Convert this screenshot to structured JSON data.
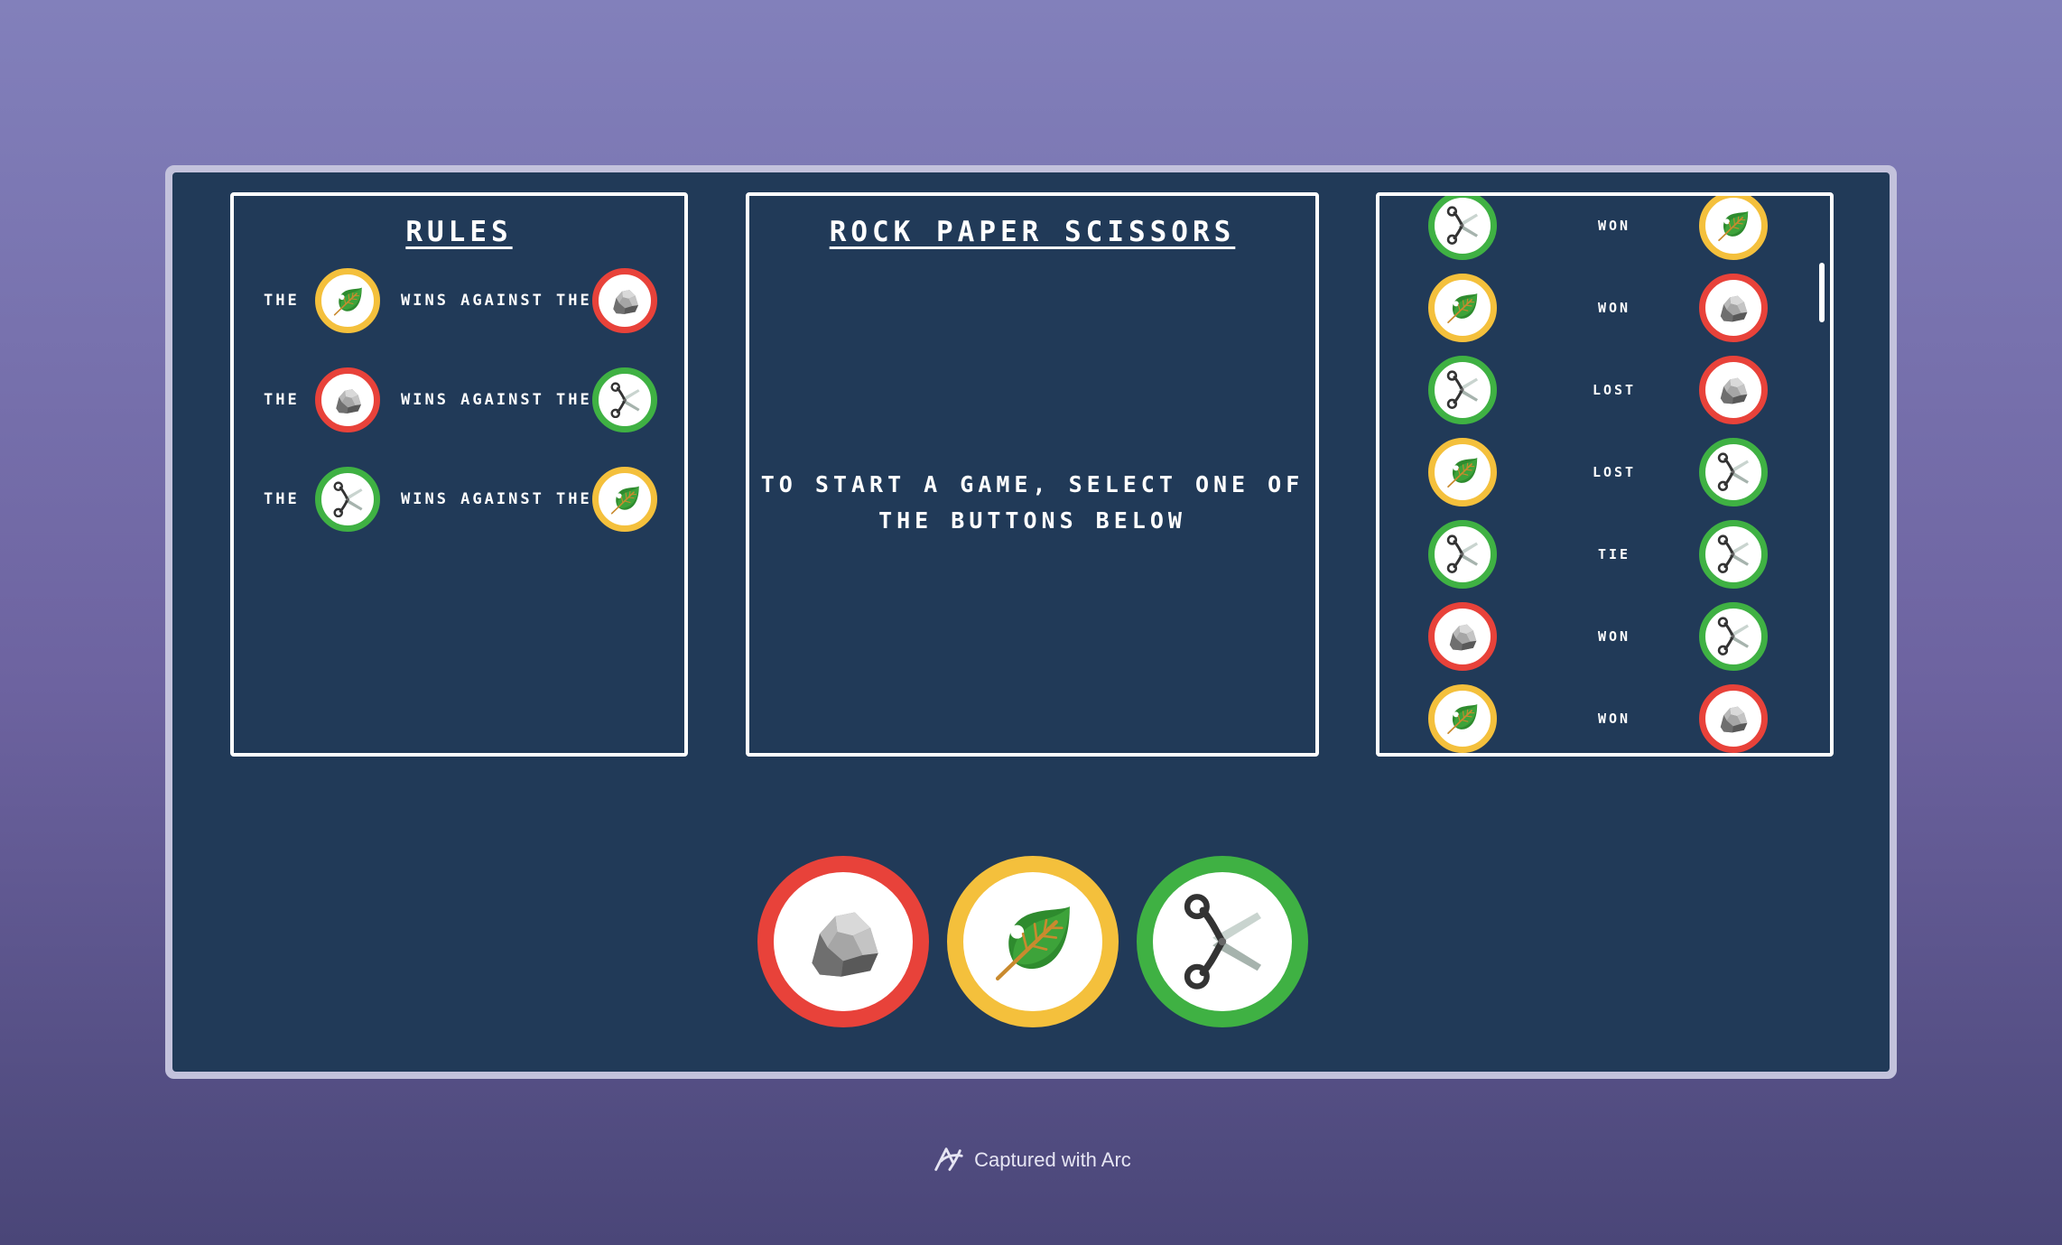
{
  "rules": {
    "title": "Rules",
    "rows": [
      {
        "the": "The",
        "winner": "paper-icon",
        "wins": "wins against the",
        "loser": "rock-icon"
      },
      {
        "the": "The",
        "winner": "rock-icon",
        "wins": "wins against the",
        "loser": "scissors-icon"
      },
      {
        "the": "The",
        "winner": "scissors-icon",
        "wins": "wins against the",
        "loser": "paper-icon"
      }
    ]
  },
  "main": {
    "title": "Rock Paper Scissors",
    "message_line1": "To start a game, select one of",
    "message_line2": "the buttons below"
  },
  "history": [
    {
      "player": "scissors-icon",
      "result": "Won",
      "opponent": "paper-icon"
    },
    {
      "player": "paper-icon",
      "result": "Won",
      "opponent": "rock-icon"
    },
    {
      "player": "scissors-icon",
      "result": "Lost",
      "opponent": "rock-icon"
    },
    {
      "player": "paper-icon",
      "result": "Lost",
      "opponent": "scissors-icon"
    },
    {
      "player": "scissors-icon",
      "result": "Tie",
      "opponent": "scissors-icon"
    },
    {
      "player": "rock-icon",
      "result": "Won",
      "opponent": "scissors-icon"
    },
    {
      "player": "paper-icon",
      "result": "Won",
      "opponent": "rock-icon"
    }
  ],
  "choices": [
    {
      "name": "rock",
      "icon": "rock-icon"
    },
    {
      "name": "paper",
      "icon": "paper-icon"
    },
    {
      "name": "scissors",
      "icon": "scissors-icon"
    }
  ],
  "colors": {
    "background": "#213a58",
    "rock": "#e8423a",
    "paper": "#f4c03c",
    "scissors": "#3fb143",
    "text": "#ffffff"
  },
  "footer": {
    "text": "Captured with Arc",
    "icon": "arc-logo-icon"
  }
}
